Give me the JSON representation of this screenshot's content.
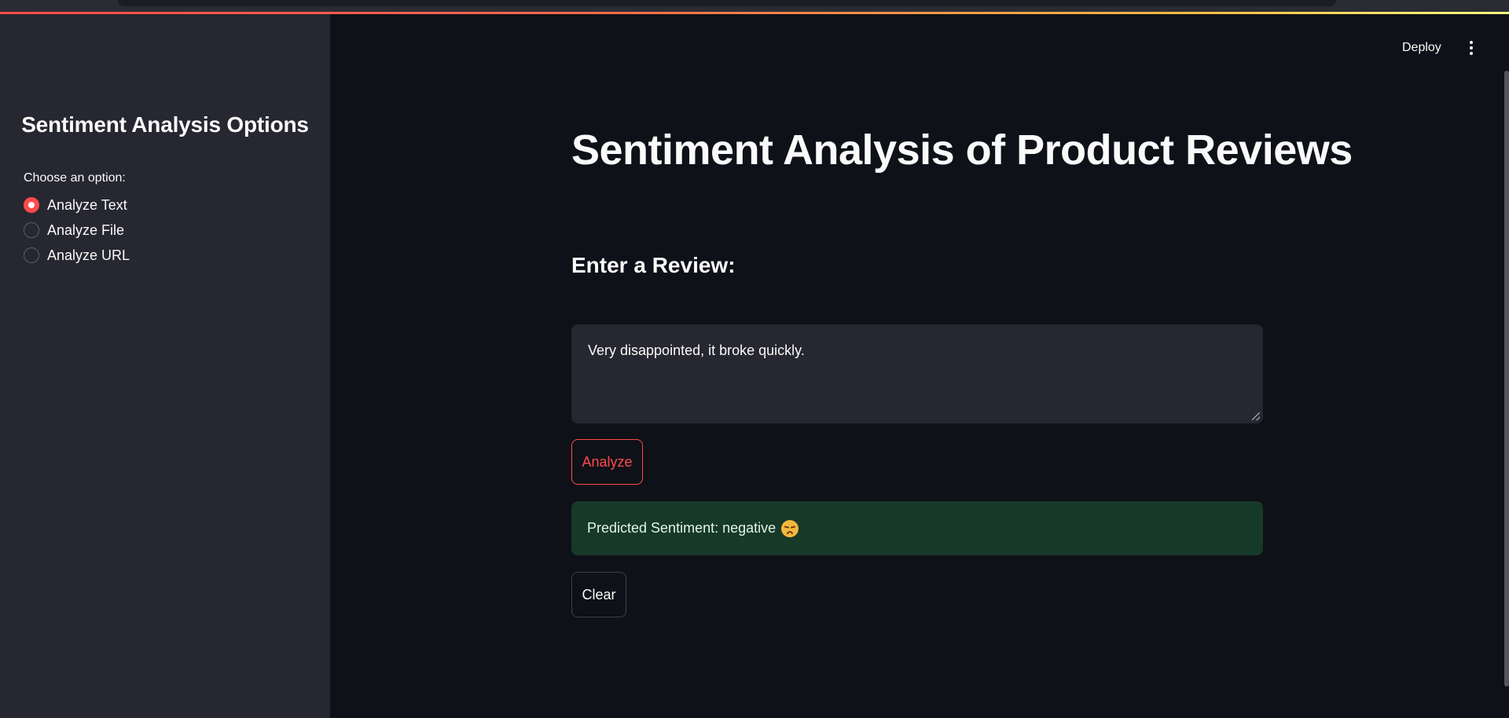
{
  "header": {
    "deploy_label": "Deploy",
    "menu_icon": "kebab-menu-icon"
  },
  "sidebar": {
    "title": "Sentiment Analysis Options",
    "radio_label": "Choose an option:",
    "options": [
      {
        "label": "Analyze Text",
        "selected": true
      },
      {
        "label": "Analyze File",
        "selected": false
      },
      {
        "label": "Analyze URL",
        "selected": false
      }
    ]
  },
  "main": {
    "title": "Sentiment Analysis of Product Reviews",
    "subheader": "Enter a Review:",
    "review_text": "Very disappointed, it broke quickly.",
    "analyze_label": "Analyze",
    "result_text": "Predicted Sentiment: negative",
    "result_emoji": "disappointed-face-icon",
    "clear_label": "Clear"
  },
  "colors": {
    "background": "#0e1117",
    "sidebar": "#262730",
    "accent": "#ff4b4b",
    "success_bg": "#173928",
    "text": "#fafafa"
  }
}
